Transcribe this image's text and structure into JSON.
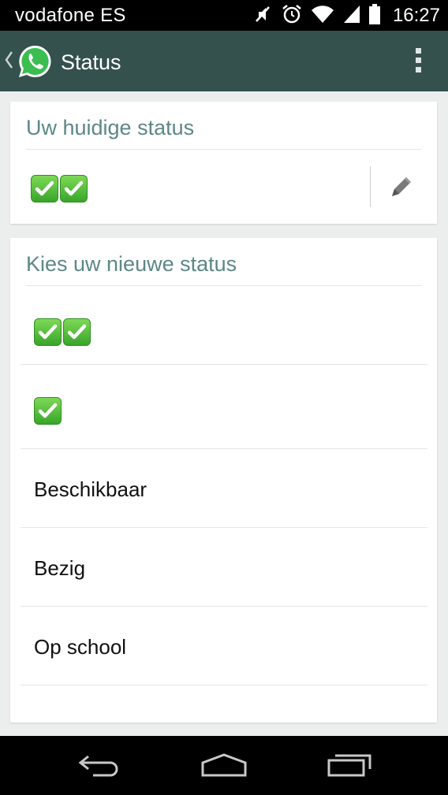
{
  "status_bar": {
    "carrier": "vodafone ES",
    "time": "16:27",
    "icons": [
      "mute-icon",
      "alarm-icon",
      "wifi-icon",
      "signal-icon",
      "battery-icon"
    ]
  },
  "action_bar": {
    "title": "Status",
    "icons": [
      "back-chevron-icon",
      "whatsapp-logo-icon",
      "overflow-menu-icon"
    ]
  },
  "current_status": {
    "heading": "Uw huidige status",
    "value_emoji": [
      "white-heavy-check-mark",
      "white-heavy-check-mark"
    ],
    "edit_icon": "pencil-icon"
  },
  "new_status": {
    "heading": "Kies uw nieuwe status",
    "items": [
      {
        "emoji": [
          "white-heavy-check-mark",
          "white-heavy-check-mark"
        ]
      },
      {
        "emoji": [
          "white-heavy-check-mark"
        ]
      },
      {
        "label": "Beschikbaar"
      },
      {
        "label": "Bezig"
      },
      {
        "label": "Op school"
      }
    ]
  },
  "nav_bar": {
    "icons": [
      "back-icon",
      "home-icon",
      "recent-apps-icon"
    ]
  },
  "colors": {
    "action_bar": "#34514e",
    "section_heading": "#5c8787",
    "background": "#eceeee",
    "check_green": "#38a52a"
  }
}
